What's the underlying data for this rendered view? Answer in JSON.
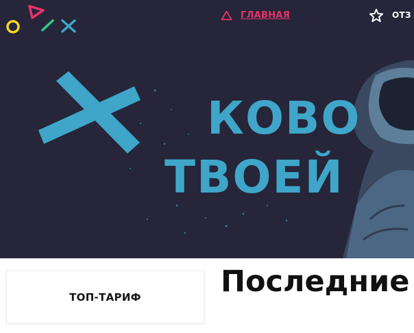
{
  "brand": {
    "colors": {
      "pink": "#e8336b",
      "yellow": "#f5d623",
      "green": "#35c88a",
      "blue": "#3fa6c9",
      "navy": "#262539"
    }
  },
  "nav": {
    "home": {
      "label": "ГЛАВНАЯ",
      "icon": "triangle-icon"
    },
    "reviews": {
      "label": "ОТЗ",
      "icon": "star-icon"
    }
  },
  "hero": {
    "line1": "КОВО",
    "line2": "ТВОЕЙ"
  },
  "tariff_card": {
    "title": "ТОП-ТАРИФ"
  },
  "section": {
    "title": "Последние"
  }
}
